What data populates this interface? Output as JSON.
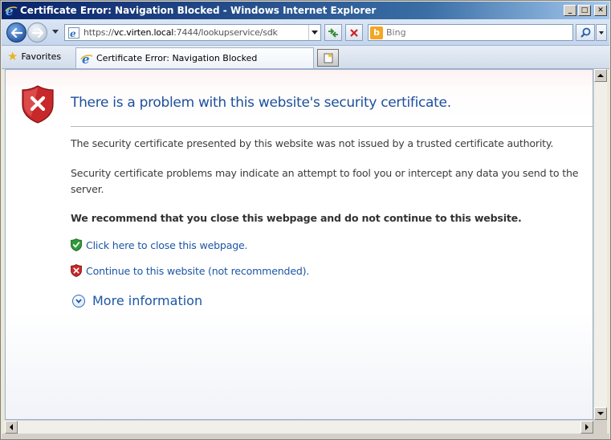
{
  "window": {
    "title": "Certificate Error: Navigation Blocked - Windows Internet Explorer",
    "controls": {
      "minimize": "_",
      "maximize": "□",
      "close": "✕"
    }
  },
  "navigation": {
    "url_prefix": "https://",
    "url_host": "vc.virten.local",
    "url_rest": ":7444/lookupservice/sdk",
    "search_placeholder": "Bing",
    "search_provider_letter": "b"
  },
  "tabs": {
    "favorites_label": "Favorites",
    "active_tab_title": "Certificate Error: Navigation Blocked"
  },
  "page": {
    "heading": "There is a problem with this website's security certificate.",
    "paragraph_1": "The security certificate presented by this website was not issued by a trusted certificate authority.",
    "paragraph_2": "Security certificate problems may indicate an attempt to fool you or intercept any data you send to the server.",
    "recommendation": "We recommend that you close this webpage and do not continue to this website.",
    "close_link": "Click here to close this webpage.",
    "continue_link": "Continue to this website (not recommended).",
    "more_info_link": "More information"
  },
  "colors": {
    "heading": "#1c4f9c",
    "link": "#1c56a6",
    "shield_red": "#c8282a",
    "shield_green": "#2f9a3a",
    "title_bar_start": "#0a246a"
  },
  "icons": {
    "title": "ie-logo-icon",
    "back": "back-arrow-icon",
    "forward": "forward-arrow-icon",
    "refresh": "refresh-icon",
    "stop": "stop-x-icon",
    "search": "magnifier-icon",
    "favorites": "star-icon",
    "new_tab": "new-tab-icon",
    "error": "red-shield-x-icon",
    "close_page": "green-shield-check-icon",
    "continue": "red-shield-x-small-icon",
    "more_info": "chevron-down-circle-icon"
  }
}
